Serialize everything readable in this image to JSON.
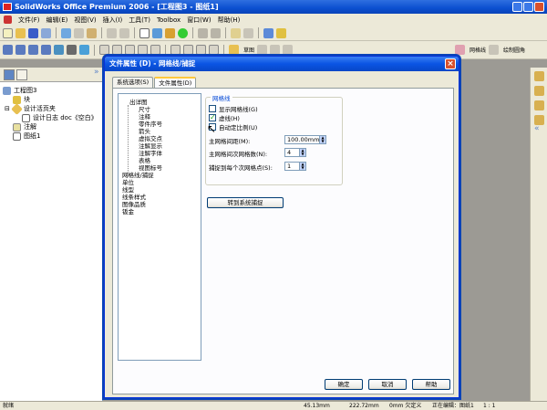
{
  "app": {
    "title": "SolidWorks Office Premium 2006 - [工程图3 - 图纸1]"
  },
  "menu": [
    "文件(F)",
    "编辑(E)",
    "视图(V)",
    "插入(I)",
    "工具(T)",
    "Toolbox",
    "窗口(W)",
    "帮助(H)"
  ],
  "toolbar2": {
    "label_a": "草图",
    "label_b": "网格线",
    "label_c": "绘制圆角"
  },
  "tree": {
    "items": [
      {
        "label": "工程图3"
      },
      {
        "label": "块"
      },
      {
        "label": "设计活页夹"
      },
      {
        "label": "设计日志 doc《空白》"
      },
      {
        "label": "注解"
      },
      {
        "label": "图纸1"
      }
    ]
  },
  "dialog": {
    "title": "文件属性 (D) - 网格线/捕捉",
    "tabs": [
      "系统选项(S)",
      "文件属性(D)"
    ],
    "categories": [
      {
        "label": "出详图",
        "level": 0
      },
      {
        "label": "尺寸",
        "level": 1
      },
      {
        "label": "注释",
        "level": 1
      },
      {
        "label": "零件序号",
        "level": 1
      },
      {
        "label": "箭头",
        "level": 1
      },
      {
        "label": "虚拟交点",
        "level": 1
      },
      {
        "label": "注解显示",
        "level": 1
      },
      {
        "label": "注解字体",
        "level": 1
      },
      {
        "label": "表格",
        "level": 1
      },
      {
        "label": "视图标号",
        "level": 1
      },
      {
        "label": "网格线/捕捉",
        "level": 0
      },
      {
        "label": "单位",
        "level": 0
      },
      {
        "label": "线型",
        "level": 0
      },
      {
        "label": "线条样式",
        "level": 0
      },
      {
        "label": "图像品质",
        "level": 0
      },
      {
        "label": "钣金",
        "level": 0
      }
    ],
    "grid": {
      "group_title": "网格线",
      "show_grid_label": "显示网格线(G)",
      "show_grid_checked": false,
      "dash_label": "虚线(H)",
      "dash_checked": true,
      "auto_scale_label": "自动定比例(U)",
      "auto_scale_checked": false,
      "major_spacing_label": "主网格间距(M):",
      "major_spacing_value": "100.00mm",
      "minor_lines_label": "主网格间次网格数(N):",
      "minor_lines_value": "4",
      "snap_points_label": "捕捉到每个次网格点(S):",
      "snap_points_value": "1"
    },
    "go_to_system_snap": "转到系统捕捉",
    "ok": "确定",
    "cancel": "取消",
    "help": "帮助"
  },
  "status": {
    "left": "就绪",
    "x": "45.13mm",
    "y": "222.72mm",
    "z": "0mm 欠定义",
    "editing": "正在编辑：图纸1",
    "scale": "1 : 1"
  },
  "colors": {
    "titlebar": "#0a54e3",
    "dialog_bg": "#ece9d8",
    "accent_tab": "#ffc83c",
    "group_title": "#0046d5"
  }
}
